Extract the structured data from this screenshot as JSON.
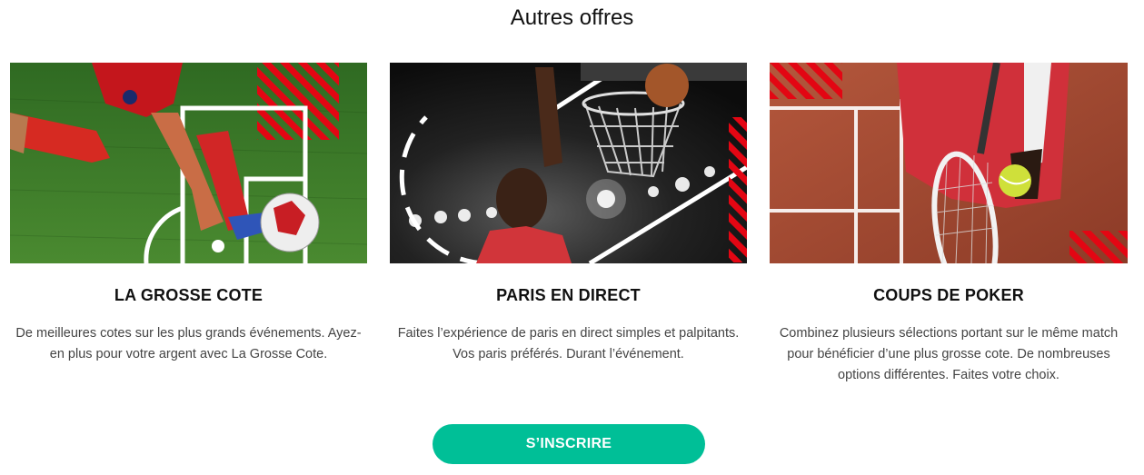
{
  "section": {
    "title": "Autres offres"
  },
  "cards": [
    {
      "title": "LA GROSSE COTE",
      "description": "De meilleures cotes sur les plus grands événements. Ayez-en plus pour votre argent avec La Grosse Cote.",
      "image": "football-player-kicking-ball"
    },
    {
      "title": "PARIS EN DIRECT",
      "description": "Faites l’expérience de paris en direct simples et palpitants. Vos paris préférés. Durant l’événement.",
      "image": "basketball-player-dunking"
    },
    {
      "title": "COUPS DE POKER",
      "description": "Combinez plusieurs sélections portant sur le même match pour bénéficier d’une plus grosse cote. De nombreuses options différentes. Faites votre choix.",
      "image": "tennis-player-holding-ball"
    }
  ],
  "cta": {
    "label": "S’INSCRIRE"
  },
  "colors": {
    "accent": "#00bf97",
    "stripe": "#e30613",
    "grass": "#3f7a2a"
  }
}
